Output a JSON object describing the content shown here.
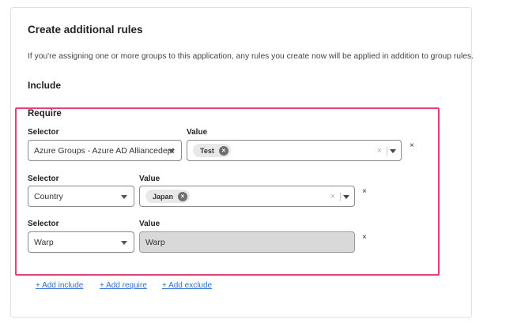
{
  "title": "Create additional rules",
  "description": "If you're assigning one or more groups to this application, any rules you create now will be applied in addition to group rules.",
  "include_heading": "Include",
  "require": {
    "heading": "Require",
    "rows": [
      {
        "selector_label": "Selector",
        "selector_value": "Azure Groups - Azure AD Alliancedept",
        "value_label": "Value",
        "value_chip": "Test",
        "remove_label": "×"
      },
      {
        "selector_label": "Selector",
        "selector_value": "Country",
        "value_label": "Value",
        "value_chip": "Japan",
        "remove_label": "×"
      },
      {
        "selector_label": "Selector",
        "selector_value": "Warp",
        "value_label": "Value",
        "value_text": "Warp",
        "remove_label": "×"
      }
    ]
  },
  "links": {
    "add_include": "+ Add include",
    "add_require": "+ Add require",
    "add_exclude": "+ Add exclude"
  },
  "colors": {
    "highlight_border": "#e4417c",
    "link": "#2f6fd1"
  }
}
